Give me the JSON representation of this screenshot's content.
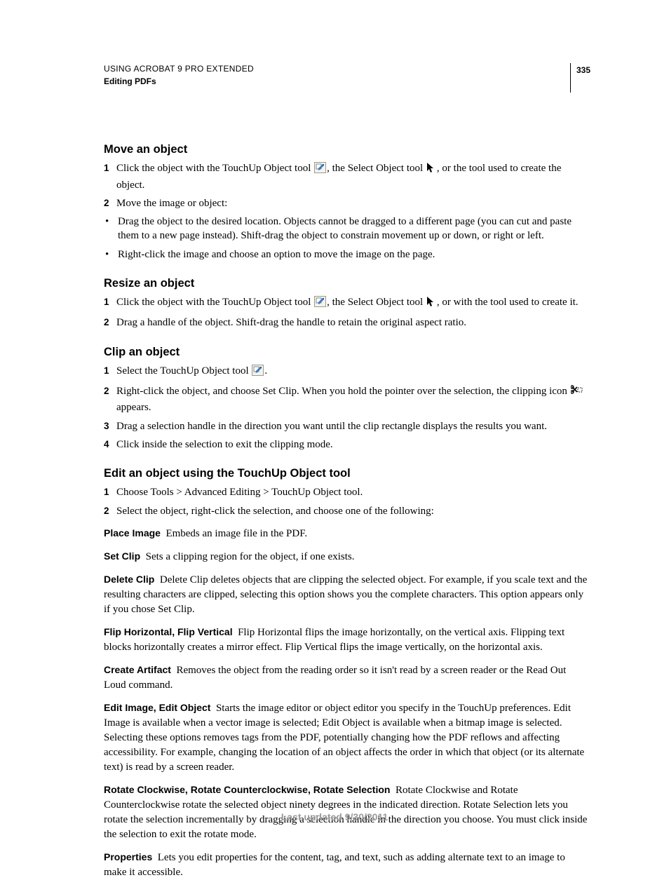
{
  "header": {
    "line1": "USING ACROBAT 9 PRO EXTENDED",
    "line2": "Editing PDFs",
    "page": "335"
  },
  "sections": {
    "s1": {
      "title": "Move an object",
      "step1a": "Click the object with the TouchUp Object tool ",
      "step1b": ", the Select Object tool ",
      "step1c": ", or the tool used to create the object.",
      "step2": "Move the image or object:",
      "bullet1": "Drag the object to the desired location. Objects cannot be dragged to a different page (you can cut and paste them to a new page instead). Shift-drag the object to constrain movement up or down, or right or left.",
      "bullet2": "Right-click the image and choose an option to move the image on the page."
    },
    "s2": {
      "title": "Resize an object",
      "step1a": "Click the object with the TouchUp Object tool ",
      "step1b": ", the Select Object tool ",
      "step1c": ", or with the tool used to create it.",
      "step2": "Drag a handle of the object. Shift-drag the handle to retain the original aspect ratio."
    },
    "s3": {
      "title": "Clip an object",
      "step1a": "Select the TouchUp Object tool ",
      "step1b": ".",
      "step2a": "Right-click the object, and choose Set Clip. When you hold the pointer over the selection, the clipping icon ",
      "step2b": " appears.",
      "step3": "Drag a selection handle in the direction you want until the clip rectangle displays the results you want.",
      "step4": "Click inside the selection to exit the clipping mode."
    },
    "s4": {
      "title": "Edit an object using the TouchUp Object tool",
      "step1": "Choose Tools > Advanced Editing > TouchUp Object tool.",
      "step2": "Select the object, right-click the selection, and choose one of the following:",
      "d1_term": "Place Image",
      "d1_desc": "Embeds an image file in the PDF.",
      "d2_term": "Set Clip",
      "d2_desc": "Sets a clipping region for the object, if one exists.",
      "d3_term": "Delete Clip",
      "d3_desc": "Delete Clip deletes objects that are clipping the selected object. For example, if you scale text and the resulting characters are clipped, selecting this option shows you the complete characters. This option appears only if you chose Set Clip.",
      "d4_term": "Flip Horizontal, Flip Vertical",
      "d4_desc": "Flip Horizontal flips the image horizontally, on the vertical axis. Flipping text blocks horizontally creates a mirror effect. Flip Vertical flips the image vertically, on the horizontal axis.",
      "d5_term": "Create Artifact",
      "d5_desc": "Removes the object from the reading order so it isn't read by a screen reader or the Read Out Loud command.",
      "d6_term": "Edit Image, Edit Object",
      "d6_desc": "Starts the image editor or object editor you specify in the TouchUp preferences. Edit Image is available when a vector image is selected; Edit Object is available when a bitmap image is selected. Selecting these options removes tags from the PDF, potentially changing how the PDF reflows and affecting accessibility. For example, changing the location of an object affects the order in which that object (or its alternate text) is read by a screen reader.",
      "d7_term": "Rotate Clockwise, Rotate Counterclockwise, Rotate Selection",
      "d7_desc": "Rotate Clockwise and Rotate Counterclockwise rotate the selected object ninety degrees in the indicated direction. Rotate Selection lets you rotate the selection incrementally by dragging a selection handle in the direction you choose. You must click inside the selection to exit the rotate mode.",
      "d8_term": "Properties",
      "d8_desc": "Lets you edit properties for the content, tag, and text, such as adding alternate text to an image to make it accessible."
    }
  },
  "footer": "Last updated 9/30/2011"
}
